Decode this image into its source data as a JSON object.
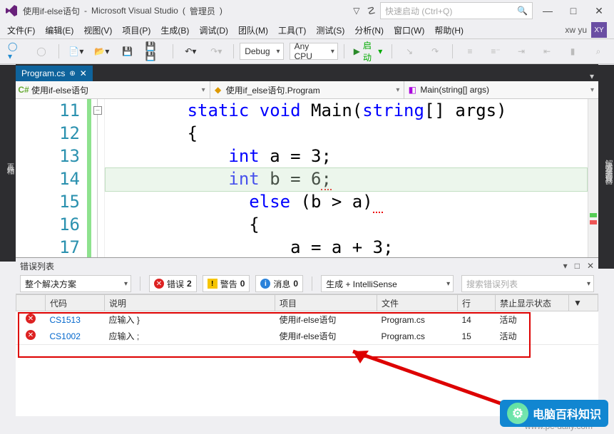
{
  "title": {
    "project": "使用if-else语句",
    "app": "Microsoft Visual Studio",
    "role": "管理员"
  },
  "quick_launch": {
    "placeholder": "快速启动 (Ctrl+Q)"
  },
  "window_buttons": {
    "min": "—",
    "max": "□",
    "close": "✕"
  },
  "menu": {
    "file": "文件(F)",
    "edit": "编辑(E)",
    "view": "视图(V)",
    "project": "项目(P)",
    "build": "生成(B)",
    "debug": "调试(D)",
    "team": "团队(M)",
    "tools": "工具(T)",
    "test": "测试(S)",
    "analyze": "分析(N)",
    "window": "窗口(W)",
    "help": "帮助(H)"
  },
  "user": {
    "name": "xw yu",
    "badge": "XY"
  },
  "toolbar": {
    "config": "Debug",
    "platform": "Any CPU",
    "start_label": "启动"
  },
  "left_tabs": [
    "工具箱"
  ],
  "right_tabs": [
    "解决方案资源管理器",
    "团队资源管理器",
    "诊断工具",
    "属性"
  ],
  "document": {
    "tab": "Program.cs"
  },
  "nav": {
    "left_icon": "csharp",
    "left": "使用if-else语句",
    "mid_icon": "class",
    "mid": "使用if_else语句.Program",
    "right_icon": "method",
    "right": "Main(string[] args)"
  },
  "editor": {
    "line_start": 11,
    "lines": [
      {
        "n": 11,
        "indent": "        ",
        "tokens": [
          {
            "t": "static",
            "c": "kw"
          },
          {
            "t": " "
          },
          {
            "t": "void",
            "c": "kw"
          },
          {
            "t": " "
          },
          {
            "t": "Main",
            "c": "func"
          },
          {
            "t": "("
          },
          {
            "t": "string",
            "c": "kw"
          },
          {
            "t": "[] "
          },
          {
            "t": "args",
            "c": "ident"
          },
          {
            "t": ")"
          }
        ]
      },
      {
        "n": 12,
        "indent": "        ",
        "tokens": [
          {
            "t": "{"
          }
        ]
      },
      {
        "n": 13,
        "indent": "            ",
        "tokens": [
          {
            "t": "int",
            "c": "kw"
          },
          {
            "t": " a = 3;"
          }
        ]
      },
      {
        "n": 14,
        "indent": "            ",
        "tokens": [
          {
            "t": "int",
            "c": "kw"
          },
          {
            "t": " b = 6"
          },
          {
            "t": ";",
            "c": "squiggle"
          }
        ]
      },
      {
        "n": 15,
        "indent": "              ",
        "tokens": [
          {
            "t": "else",
            "c": "kw"
          },
          {
            "t": " (b > a)"
          },
          {
            "t": " ",
            "c": "squiggle"
          }
        ]
      },
      {
        "n": 16,
        "indent": "              ",
        "tokens": [
          {
            "t": "{"
          }
        ]
      },
      {
        "n": 17,
        "indent": "                  ",
        "tokens": [
          {
            "t": "a = a + 3;"
          }
        ]
      }
    ]
  },
  "error_list": {
    "title": "错误列表",
    "scope": "整个解决方案",
    "pills": {
      "errors_label": "错误",
      "errors_count": "2",
      "warnings_label": "警告",
      "warnings_count": "0",
      "info_label": "消息",
      "info_count": "0"
    },
    "filter_label": "生成 + IntelliSense",
    "search_placeholder": "搜索错误列表",
    "columns": {
      "icon": "",
      "code": "代码",
      "desc": "说明",
      "project": "项目",
      "file": "文件",
      "line": "行",
      "state": "禁止显示状态"
    },
    "rows": [
      {
        "code": "CS1513",
        "desc": "应输入 }",
        "project": "使用if-else语句",
        "file": "Program.cs",
        "line": "14",
        "state": "活动"
      },
      {
        "code": "CS1002",
        "desc": "应输入 ;",
        "project": "使用if-else语句",
        "file": "Program.cs",
        "line": "15",
        "state": "活动"
      }
    ]
  },
  "branding": {
    "text": "电脑百科知识",
    "watermark": "www.pc-daily.com"
  }
}
